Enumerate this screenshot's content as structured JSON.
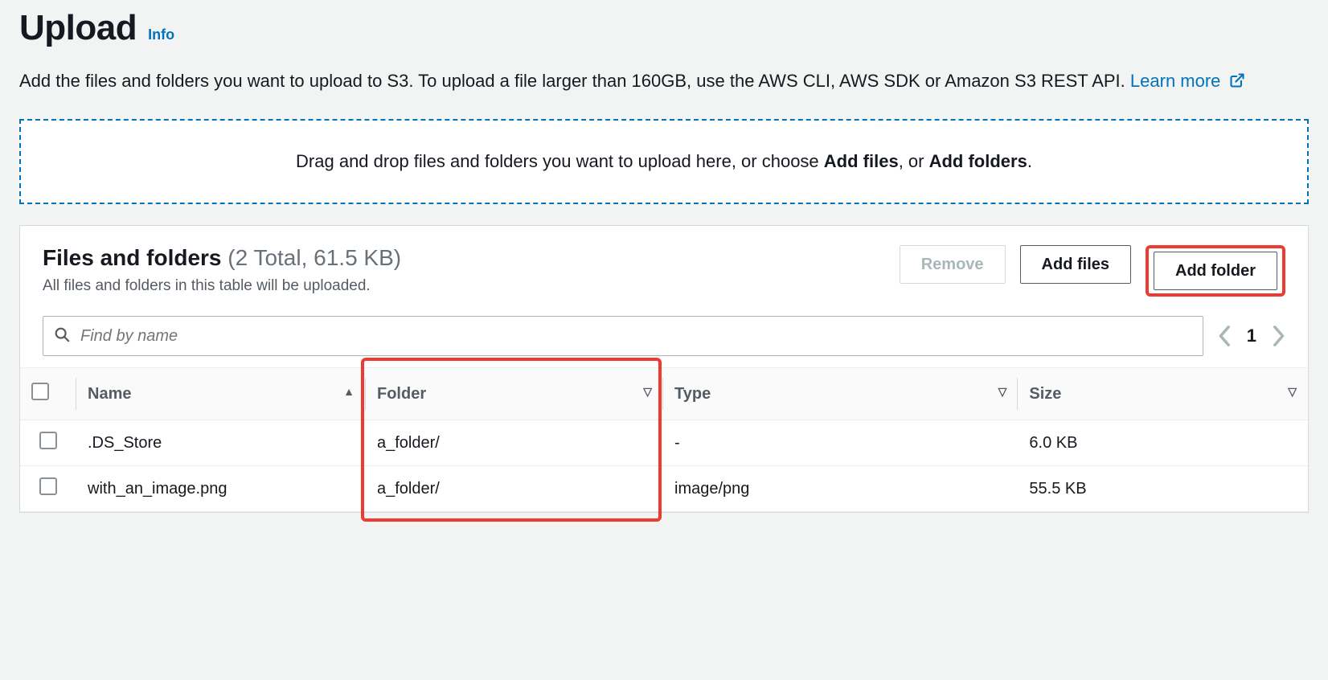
{
  "header": {
    "title": "Upload",
    "info": "Info",
    "description_prefix": "Add the files and folders you want to upload to S3. To upload a file larger than 160GB, use the AWS CLI, AWS SDK or Amazon S3 REST API. ",
    "learn_more": "Learn more"
  },
  "dropzone": {
    "prefix": "Drag and drop files and folders you want to upload here, or choose ",
    "add_files_bold": "Add files",
    "or": ", or ",
    "add_folders_bold": "Add folders",
    "suffix": "."
  },
  "panel": {
    "title": "Files and folders",
    "count_text": "(2 Total, 61.5 KB)",
    "subtitle": "All files and folders in this table will be uploaded."
  },
  "actions": {
    "remove": "Remove",
    "add_files": "Add files",
    "add_folder": "Add folder"
  },
  "search": {
    "placeholder": "Find by name"
  },
  "pager": {
    "page": "1"
  },
  "columns": {
    "name": "Name",
    "folder": "Folder",
    "type": "Type",
    "size": "Size"
  },
  "rows": [
    {
      "name": ".DS_Store",
      "folder": "a_folder/",
      "type": "-",
      "size": "6.0 KB"
    },
    {
      "name": "with_an_image.png",
      "folder": "a_folder/",
      "type": "image/png",
      "size": "55.5 KB"
    }
  ]
}
